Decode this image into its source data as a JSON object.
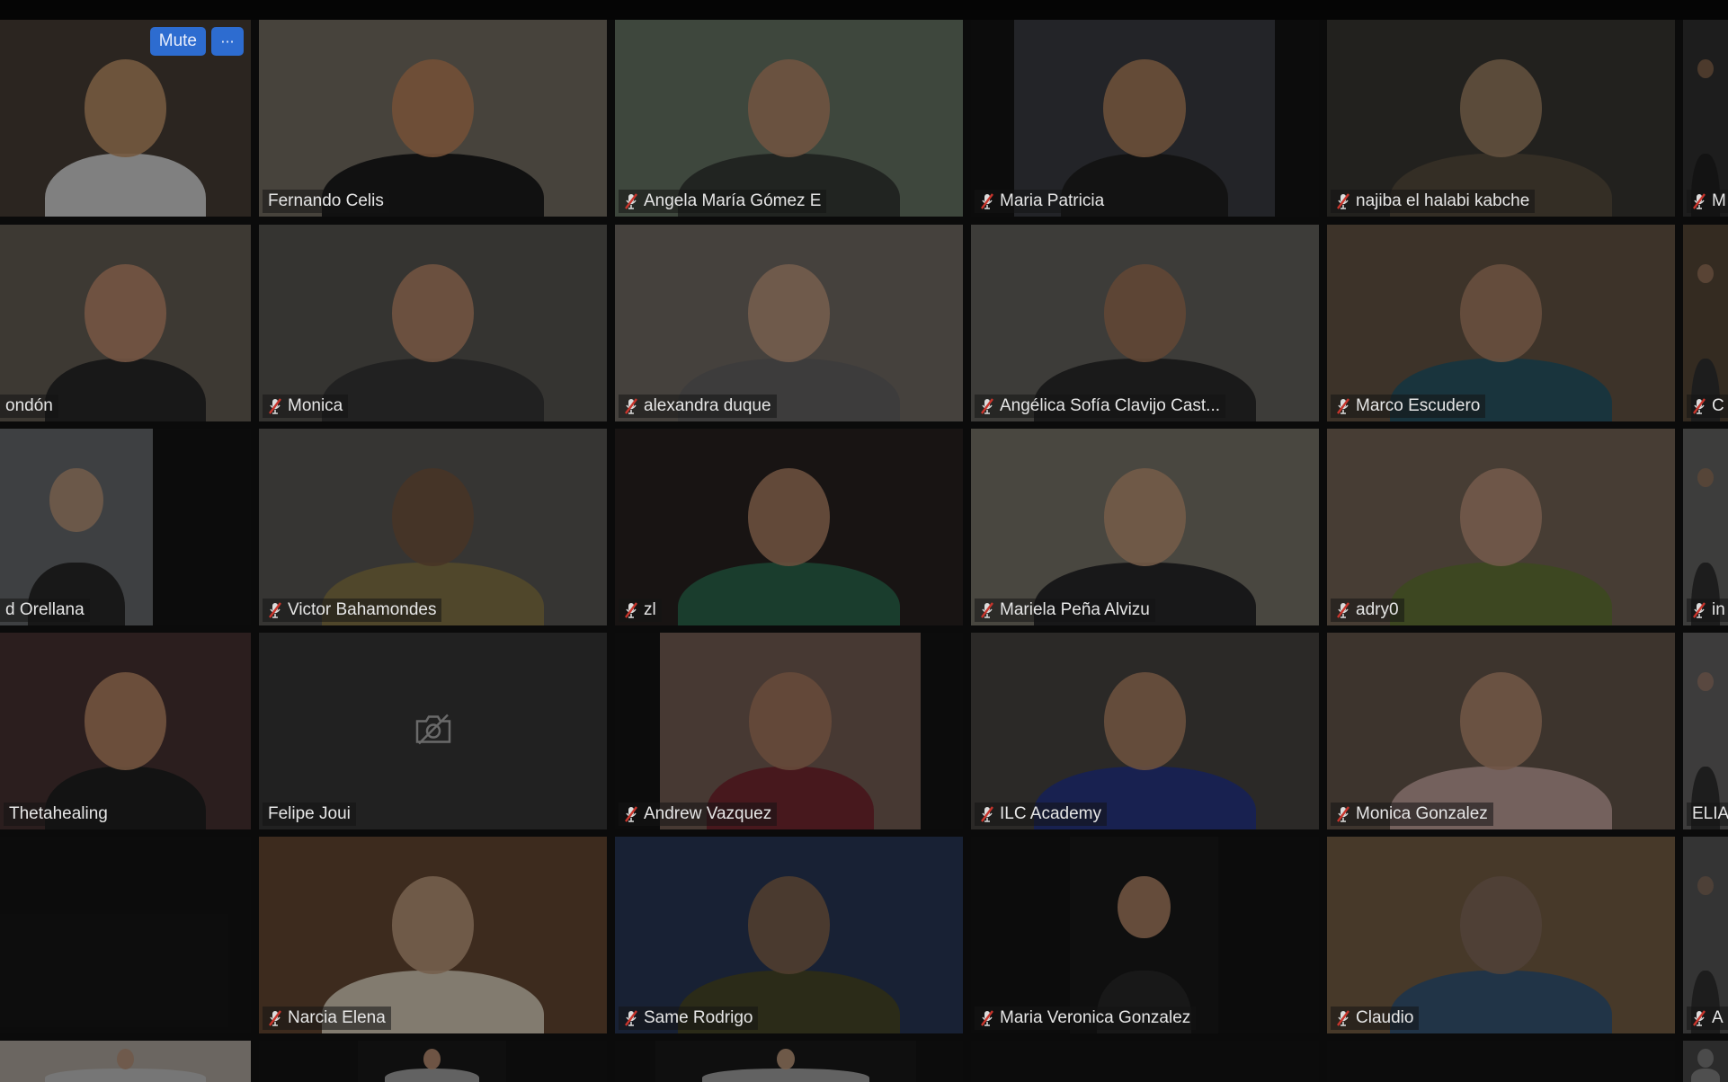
{
  "meeting": {
    "view": "Gallery View",
    "active_speaker": "Fernando Celis"
  },
  "self_view": {
    "mute_label": "Mute",
    "more_label": "···"
  },
  "colors": {
    "active_border": "#b8b85a",
    "button_blue": "#2d6cd0",
    "muted_mic_red": "#c8352c"
  },
  "participants": [
    {
      "name": "",
      "muted": false,
      "camera": true
    },
    {
      "name": "Fernando Celis",
      "muted": false,
      "camera": true,
      "active": true
    },
    {
      "name": "Angela María Gómez E",
      "muted": true,
      "camera": true
    },
    {
      "name": "Maria Patricia",
      "muted": true,
      "camera": true
    },
    {
      "name": "najiba el halabi kabche",
      "muted": true,
      "camera": true
    },
    {
      "name": "M",
      "muted": true,
      "camera": true
    },
    {
      "name": "ondón",
      "muted": false,
      "camera": true
    },
    {
      "name": "Monica",
      "muted": true,
      "camera": true
    },
    {
      "name": "alexandra duque",
      "muted": true,
      "camera": true
    },
    {
      "name": "Angélica Sofía Clavijo Cast...",
      "muted": true,
      "camera": true
    },
    {
      "name": "Marco Escudero",
      "muted": true,
      "camera": true
    },
    {
      "name": "C",
      "muted": true,
      "camera": true
    },
    {
      "name": "d Orellana",
      "muted": false,
      "camera": true
    },
    {
      "name": "Victor Bahamondes",
      "muted": true,
      "camera": true
    },
    {
      "name": "zl",
      "muted": true,
      "camera": true
    },
    {
      "name": "Mariela Peña Alvizu",
      "muted": true,
      "camera": true
    },
    {
      "name": "adry0",
      "muted": true,
      "camera": true
    },
    {
      "name": "in",
      "muted": true,
      "camera": true
    },
    {
      "name": "Thetahealing",
      "muted": false,
      "camera": true
    },
    {
      "name": "Felipe Joui",
      "muted": false,
      "camera": false
    },
    {
      "name": "Andrew Vazquez",
      "muted": true,
      "camera": true
    },
    {
      "name": "ILC Academy",
      "muted": true,
      "camera": true
    },
    {
      "name": "Monica Gonzalez",
      "muted": true,
      "camera": true
    },
    {
      "name": "ELIA",
      "muted": false,
      "camera": true
    },
    {
      "name": "",
      "muted": false,
      "camera": false
    },
    {
      "name": "Narcia Elena",
      "muted": true,
      "camera": true
    },
    {
      "name": "Same Rodrigo",
      "muted": true,
      "camera": true
    },
    {
      "name": "Maria Veronica Gonzalez",
      "muted": true,
      "camera": true
    },
    {
      "name": "Claudio",
      "muted": true,
      "camera": true
    },
    {
      "name": "A",
      "muted": true,
      "camera": true
    },
    {
      "name": "",
      "muted": false,
      "camera": true
    },
    {
      "name": "",
      "muted": false,
      "camera": true
    },
    {
      "name": "",
      "muted": false,
      "camera": true
    },
    {
      "name": "",
      "muted": false,
      "camera": false
    },
    {
      "name": "",
      "muted": false,
      "camera": false
    },
    {
      "name": "",
      "muted": false,
      "camera": true
    }
  ]
}
